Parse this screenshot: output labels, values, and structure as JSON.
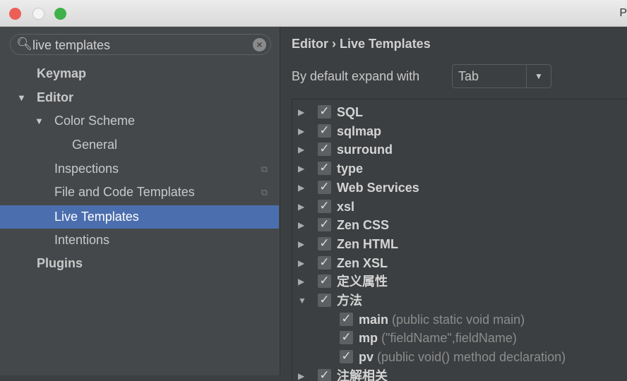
{
  "window": {
    "title": "P"
  },
  "sidebar": {
    "search": "live templates",
    "items": [
      {
        "label": "Keymap"
      },
      {
        "label": "Editor"
      },
      {
        "label": "Color Scheme"
      },
      {
        "label": "General"
      },
      {
        "label": "Inspections"
      },
      {
        "label": "File and Code Templates"
      },
      {
        "label": "Live Templates"
      },
      {
        "label": "Intentions"
      },
      {
        "label": "Plugins"
      }
    ]
  },
  "main": {
    "breadcrumb": "Editor › Live Templates",
    "expand_label": "By default expand with",
    "expand_value": "Tab",
    "groups": [
      {
        "label": "SQL"
      },
      {
        "label": "sqlmap"
      },
      {
        "label": "surround"
      },
      {
        "label": "type"
      },
      {
        "label": "Web Services"
      },
      {
        "label": "xsl"
      },
      {
        "label": "Zen CSS"
      },
      {
        "label": "Zen HTML"
      },
      {
        "label": "Zen XSL"
      },
      {
        "label": "定义属性"
      },
      {
        "label": "方法"
      }
    ],
    "templates": [
      {
        "abbr": "main",
        "desc": "(public static void main)"
      },
      {
        "abbr": "mp",
        "desc": "(\"fieldName\",fieldName)"
      },
      {
        "abbr": "pv",
        "desc": "(public void() method declaration)"
      }
    ],
    "last_group": "注解相关"
  },
  "colors": {
    "selection": "#4b6eaf"
  }
}
